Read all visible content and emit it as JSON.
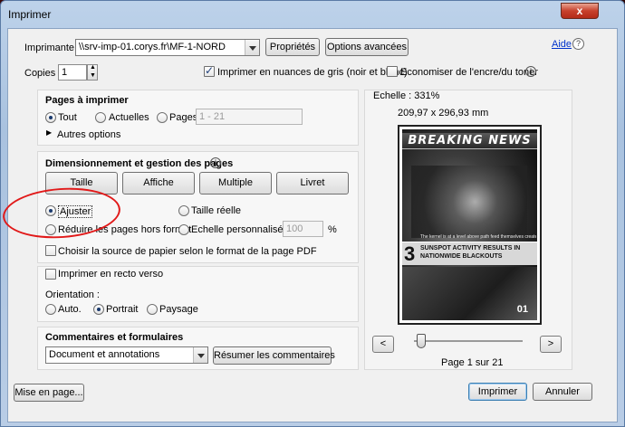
{
  "window": {
    "title": "Imprimer",
    "close_label": "x"
  },
  "printer": {
    "label": "Imprimante :",
    "selected": "\\\\srv-imp-01.corys.fr\\MF-1-NORD",
    "properties_label": "Propriétés",
    "advanced_label": "Options avancées",
    "help_label": "Aide",
    "help_icon_label": "?"
  },
  "copies": {
    "label": "Copies :",
    "value": "1",
    "grayscale_label": "Imprimer en nuances de gris (noir et blanc)",
    "grayscale_checked": true,
    "save_ink_label": "Economiser de l'encre/du toner",
    "save_ink_checked": false,
    "info_icon_label": "i"
  },
  "pages": {
    "section_title": "Pages à imprimer",
    "all_label": "Tout",
    "current_label": "Actuelles",
    "pages_label": "Pages",
    "pages_range": "1 - 21",
    "more_options_label": "Autres options"
  },
  "sizing": {
    "section_title": "Dimensionnement et gestion des pages",
    "info_icon_label": "i",
    "tabs": [
      "Taille",
      "Affiche",
      "Multiple",
      "Livret"
    ],
    "fit_label": "Ajuster",
    "actual_size_label": "Taille réelle",
    "shrink_label": "Réduire les pages hors format",
    "custom_scale_label": "Echelle personnalisée :",
    "custom_scale_value": "100",
    "percent": "%",
    "choose_source_label": "Choisir la source de papier selon le format de la page PDF"
  },
  "duplex": {
    "label": "Imprimer en recto verso"
  },
  "orientation": {
    "label": "Orientation :",
    "auto_label": "Auto.",
    "portrait_label": "Portrait",
    "landscape_label": "Paysage"
  },
  "comments": {
    "section_title": "Commentaires et formulaires",
    "selected": "Document et annotations",
    "summarize_label": "Résumer les commentaires"
  },
  "preview": {
    "scale_label": "Echelle : 331%",
    "dimensions": "209,97 x 296,93 mm",
    "banner": "BREAKING NEWS",
    "caption": "The kernel is at a level above path feed themselves created when the",
    "strip_number": "3",
    "strip_line1": "SUNSPOT ACTIVITY RESULTS IN",
    "strip_line2": "NATIONWIDE BLACKOUTS",
    "page_number_on_image": "01",
    "prev_label": "<",
    "next_label": ">",
    "page_indicator": "Page 1 sur 21",
    "slider_position": 0.05
  },
  "footer": {
    "page_setup_label": "Mise en page...",
    "print_label": "Imprimer",
    "cancel_label": "Annuler"
  }
}
